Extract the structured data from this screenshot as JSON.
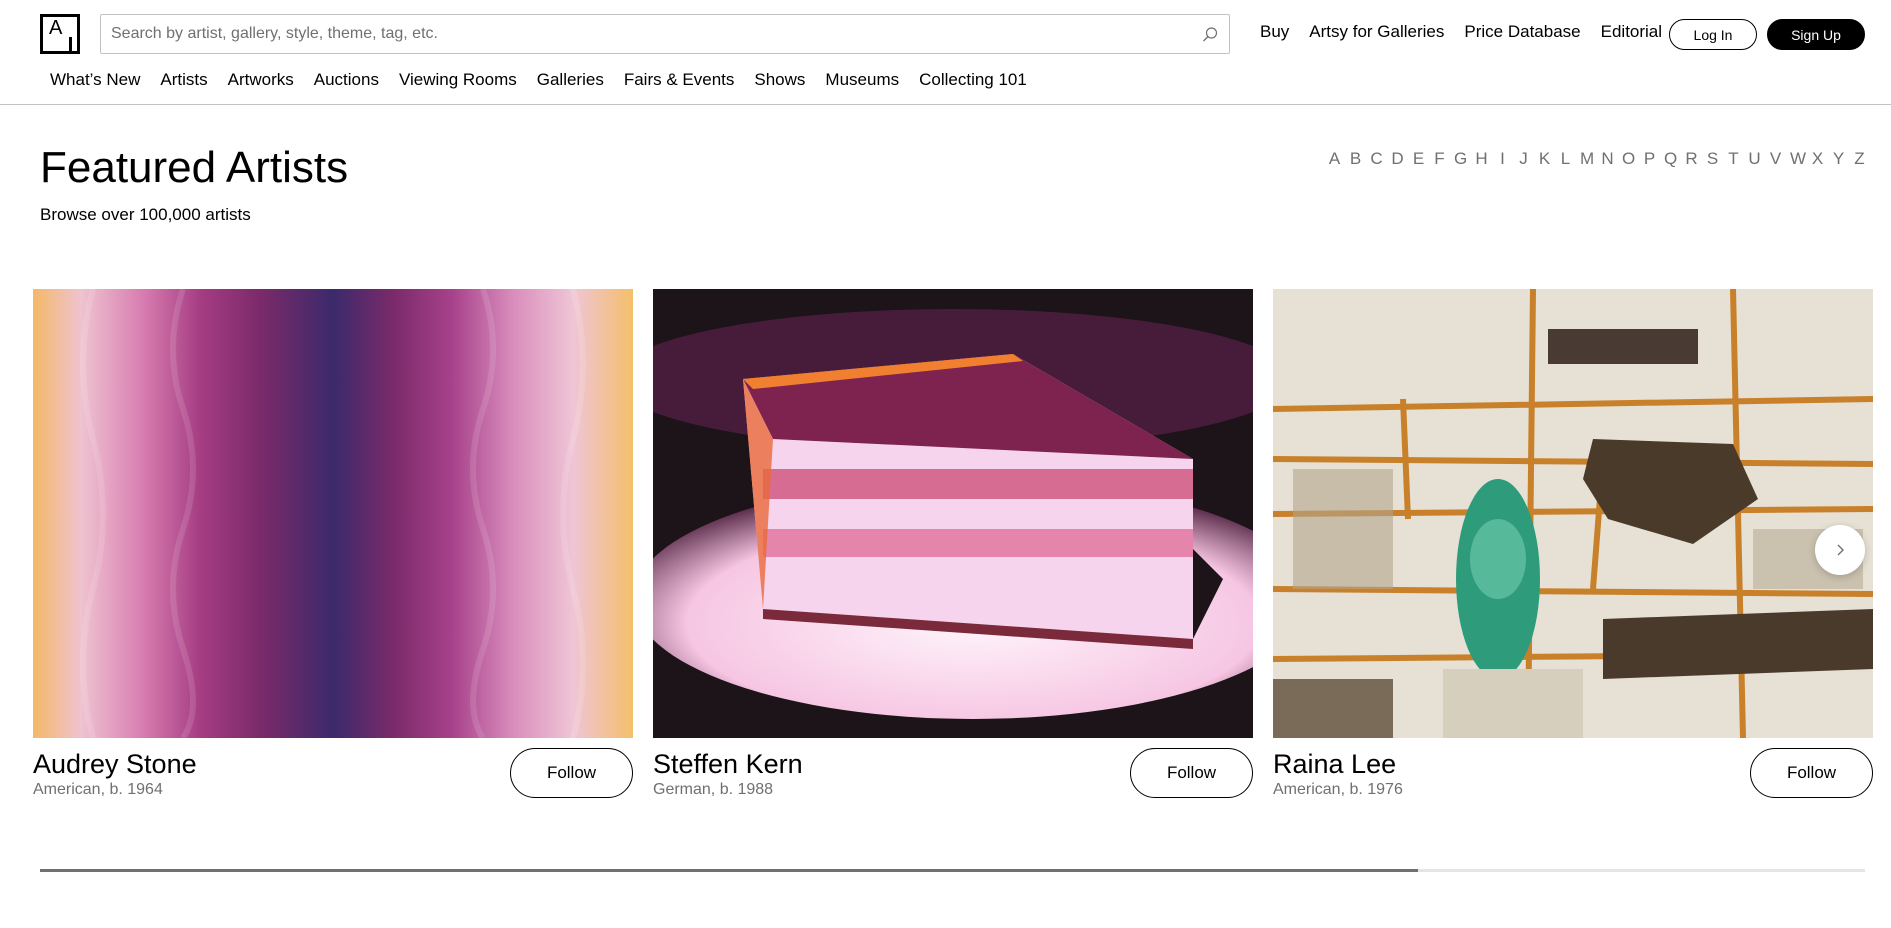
{
  "header": {
    "logo_letter": "A",
    "search_placeholder": "Search by artist, gallery, style, theme, tag, etc.",
    "links": [
      "Buy",
      "Artsy for Galleries",
      "Price Database",
      "Editorial"
    ],
    "login_label": "Log In",
    "signup_label": "Sign Up"
  },
  "nav": {
    "items": [
      "What’s New",
      "Artists",
      "Artworks",
      "Auctions",
      "Viewing Rooms",
      "Galleries",
      "Fairs & Events",
      "Shows",
      "Museums",
      "Collecting 101"
    ]
  },
  "main": {
    "title": "Featured Artists",
    "subtitle": "Browse over 100,000 artists",
    "alphabet": [
      "A",
      "B",
      "C",
      "D",
      "E",
      "F",
      "G",
      "H",
      "I",
      "J",
      "K",
      "L",
      "M",
      "N",
      "O",
      "P",
      "Q",
      "R",
      "S",
      "T",
      "U",
      "V",
      "W",
      "X",
      "Y",
      "Z"
    ]
  },
  "artists": [
    {
      "name": "Audrey Stone",
      "meta": "American, b. 1964",
      "follow_label": "Follow"
    },
    {
      "name": "Steffen Kern",
      "meta": "German, b. 1988",
      "follow_label": "Follow"
    },
    {
      "name": "Raina Lee",
      "meta": "American, b. 1976",
      "follow_label": "Follow"
    }
  ],
  "carousel": {
    "progress": 0.755
  },
  "icons": {
    "search": "search-icon",
    "next": "chevron-right-icon",
    "logo": "artsy-logo-icon"
  },
  "colors": {
    "text": "#000000",
    "muted": "#707070",
    "border": "#c2c2c2"
  }
}
